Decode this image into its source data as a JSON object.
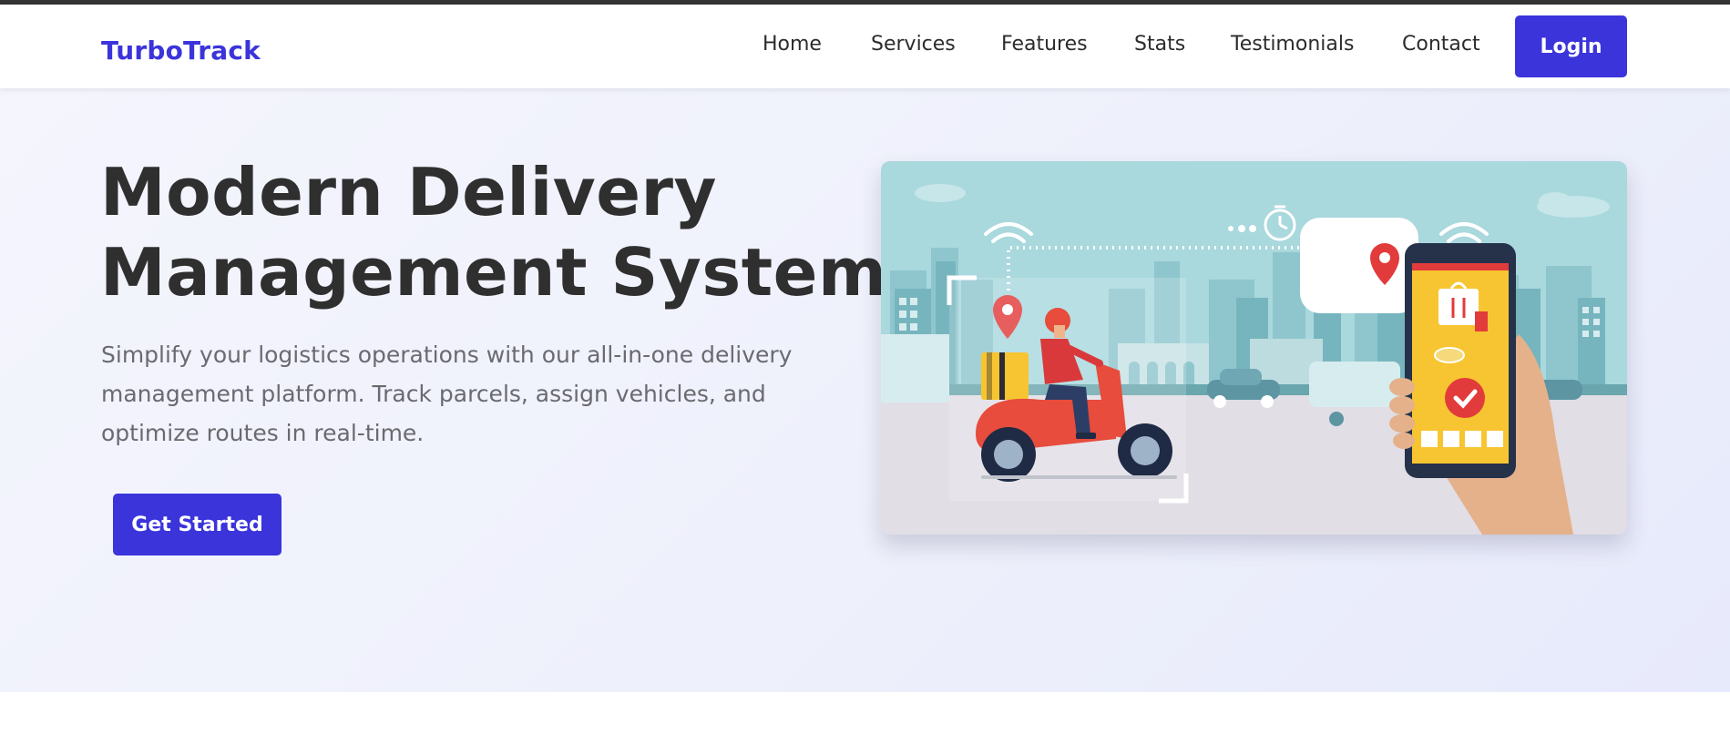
{
  "navbar": {
    "brand": "TurboTrack",
    "links": [
      "Home",
      "Services",
      "Features",
      "Stats",
      "Testimonials",
      "Contact"
    ],
    "login_label": "Login"
  },
  "hero": {
    "title_line1": "Modern Delivery",
    "title_line2": "Management System",
    "description": "Simplify your logistics operations with our all-in-one delivery management platform. Track parcels, assign vehicles, and optimize routes in real-time.",
    "cta_label": "Get Started",
    "image_icon": "delivery-scooter-illustration"
  },
  "colors": {
    "brand": "#3b34db",
    "heading": "#2f2f2f",
    "body_text": "#6a6a70",
    "hero_bg": "#eef0fb",
    "accent_red": "#e23b3b",
    "accent_yellow": "#f7c531"
  }
}
